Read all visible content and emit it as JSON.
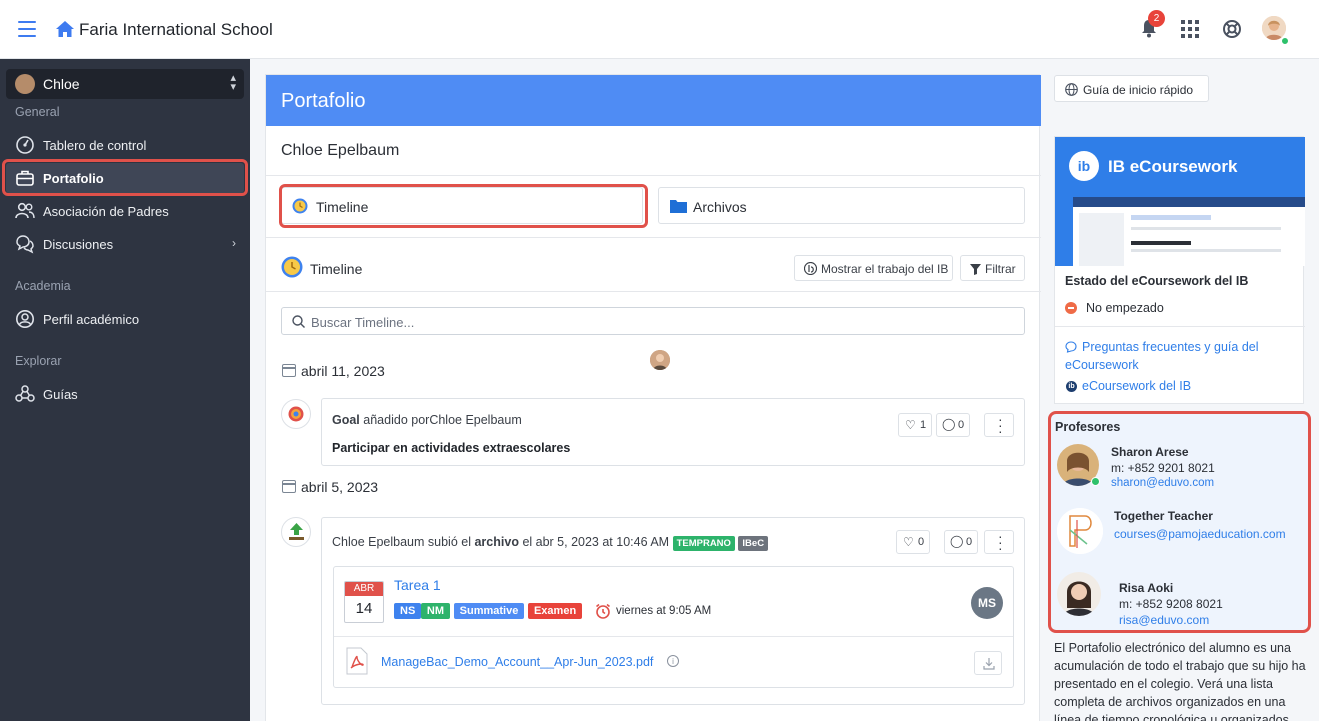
{
  "header": {
    "school_name": "Faria International School",
    "notification_count": "2"
  },
  "sidebar": {
    "user": "Chloe",
    "sections": {
      "general": "General",
      "academia": "Academia",
      "explorar": "Explorar"
    },
    "items": [
      {
        "label": "Tablero de control"
      },
      {
        "label": "Portafolio"
      },
      {
        "label": "Asociación de Padres"
      },
      {
        "label": "Discusiones"
      },
      {
        "label": "Perfil académico"
      },
      {
        "label": "Guías"
      }
    ]
  },
  "main": {
    "title": "Portafolio",
    "student_name": "Chloe Epelbaum",
    "tabs": [
      {
        "label": "Timeline"
      },
      {
        "label": "Archivos"
      }
    ],
    "timeline_title": "Timeline",
    "show_ib_button": "Mostrar el trabajo del IB",
    "filter_button": "Filtrar",
    "search_placeholder": "Buscar Timeline...",
    "entries": [
      {
        "date": "abril 11, 2023",
        "type": "Goal",
        "action": "añadido por",
        "author": "Chloe Epelbaum",
        "body": "Participar en actividades extraescolares",
        "likes": "1",
        "comments": "0"
      },
      {
        "date": "abril 5, 2023",
        "author": "Chloe Epelbaum",
        "action": "subió el",
        "object": "archivo",
        "when": "el abr 5, 2023 at 10:46 AM",
        "tags": [
          "TEMPRANO",
          "IBeC"
        ],
        "likes": "0",
        "comments": "0",
        "task": {
          "month": "ABR",
          "day": "14",
          "title": "Tarea 1",
          "labels": [
            "NS",
            "NM",
            "Summative",
            "Examen"
          ],
          "due": "viernes at 9:05 AM",
          "teacher_initials": "MS"
        },
        "file": "ManageBac_Demo_Account__Apr-Jun_2023.pdf"
      }
    ]
  },
  "right": {
    "guide_button": "Guía de inicio rápido",
    "ib_card": {
      "banner_title": "IB eCoursework",
      "status_title": "Estado del eCoursework del IB",
      "status": "No empezado",
      "faq_link": "Preguntas frecuentes y guía del eCoursework",
      "ib_link": "eCoursework del IB"
    },
    "teachers_title": "Profesores",
    "teachers": [
      {
        "name": "Sharon Arese",
        "phone": "m: +852 9201 8021",
        "email": "sharon@eduvo.com"
      },
      {
        "name": "Together Teacher",
        "email": "courses@pamojaeducation.com"
      },
      {
        "name": "Risa Aoki",
        "phone": "m: +852 9208 8021",
        "email": "risa@eduvo.com"
      }
    ],
    "description": "El Portafolio electrónico del alumno es una acumulación de todo el trabajo que su hijo ha presentado en el colegio. Verá una lista completa de archivos organizados en una línea de tiempo cronológica u organizados"
  },
  "colors": {
    "accent": "#4f8cf4",
    "sidebar": "#2e3441",
    "highlight": "#e0514a",
    "success": "#2ec16b"
  }
}
